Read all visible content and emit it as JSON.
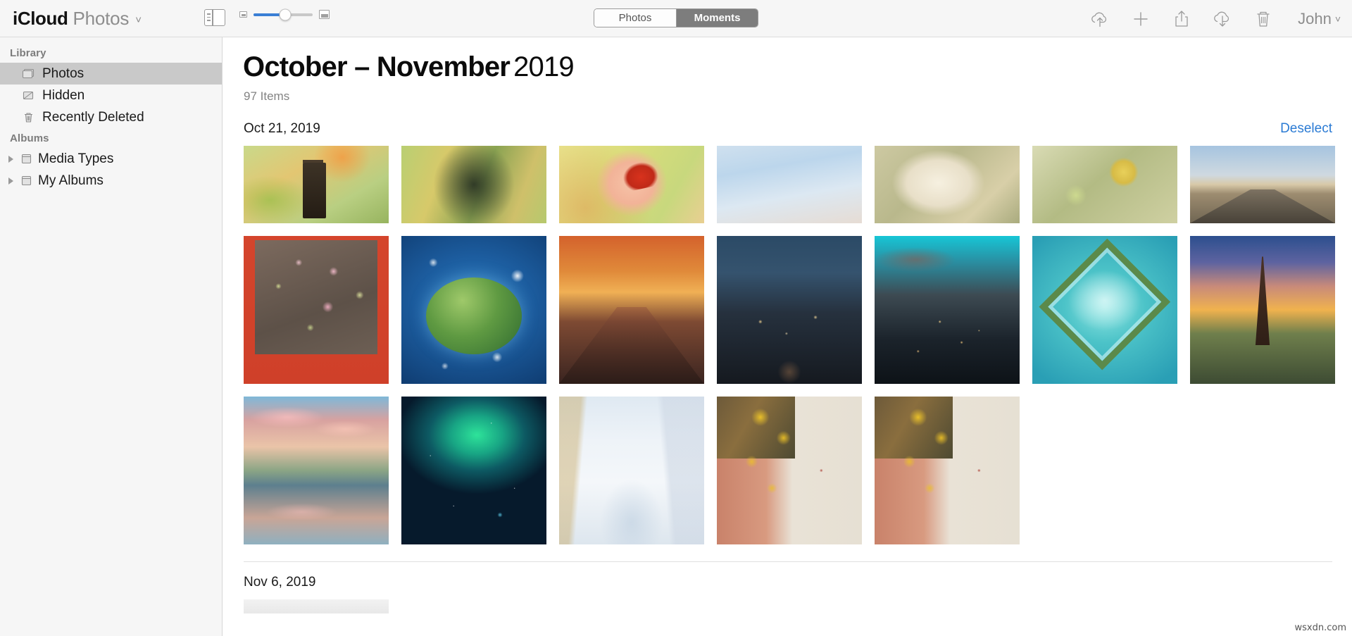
{
  "toolbar": {
    "brand_primary": "iCloud",
    "brand_secondary": "Photos",
    "brand_caret": "˅",
    "sidebar_toggle_name": "sidebar-toggle-icon",
    "zoom_slider_value": 53,
    "segments": [
      {
        "label": "Photos",
        "selected": false
      },
      {
        "label": "Moments",
        "selected": true
      }
    ],
    "icons": [
      "upload-to-icloud-icon",
      "add-icon",
      "share-icon",
      "download-from-icloud-icon",
      "delete-icon"
    ],
    "account_name": "John",
    "account_caret": "˅",
    "accent_color": "#3a7fd5"
  },
  "sidebar": {
    "sections": [
      {
        "header": "Library",
        "items": [
          {
            "label": "Photos",
            "icon": "photos-stack-icon",
            "selected": true
          },
          {
            "label": "Hidden",
            "icon": "hidden-eye-slash-icon",
            "selected": false
          },
          {
            "label": "Recently Deleted",
            "icon": "trash-icon",
            "selected": false
          }
        ]
      },
      {
        "header": "Albums",
        "items": [
          {
            "label": "Media Types",
            "icon": "album-folder-icon",
            "selected": false,
            "expandable": true
          },
          {
            "label": "My Albums",
            "icon": "album-folder-icon",
            "selected": false,
            "expandable": true
          }
        ]
      }
    ]
  },
  "main": {
    "title_range": "October – November",
    "title_year": "2019",
    "item_count": "97 Items",
    "moments": [
      {
        "date": "Oct 21, 2019",
        "action_label": "Deselect",
        "action_color": "#2b7bd4",
        "rows": [
          {
            "orientation": "landscape",
            "photos": [
              {
                "name": "photo-birdhouse-autumn",
                "art": "p-birdhouse",
                "selected": false
              },
              {
                "name": "photo-tree-autumn-leaves",
                "art": "p-tree",
                "selected": false
              },
              {
                "name": "photo-hand-holding-red-maple-leaf",
                "art": "p-leaf-hand",
                "selected": true
              },
              {
                "name": "photo-pastel-sky",
                "art": "p-sky",
                "selected": false
              },
              {
                "name": "photo-white-rose",
                "art": "p-white-rose",
                "selected": false
              },
              {
                "name": "photo-yellow-rose",
                "art": "p-yellow-rose",
                "selected": false
              },
              {
                "name": "photo-desert-road",
                "art": "p-road",
                "selected": false
              }
            ]
          },
          {
            "orientation": "portrait",
            "photos": [
              {
                "name": "photo-pink-blossoms-red-wall",
                "art": "p-blossom",
                "selected": false
              },
              {
                "name": "photo-tiny-planet-castle",
                "art": "p-planet",
                "selected": false
              },
              {
                "name": "photo-sunset-palm-street",
                "art": "p-sunset-street",
                "selected": false
              },
              {
                "name": "photo-night-city-street",
                "art": "p-night-street",
                "selected": false
              },
              {
                "name": "photo-city-skyline-dusk",
                "art": "p-city-night",
                "selected": false
              },
              {
                "name": "photo-heart-shaped-island",
                "art": "p-heart-island",
                "selected": false
              },
              {
                "name": "photo-eiffel-tower-sunset",
                "art": "p-eiffel",
                "selected": false
              }
            ]
          },
          {
            "orientation": "portrait",
            "photos": [
              {
                "name": "photo-cloud-reflection-lake",
                "art": "p-cloud-reflection",
                "selected": false
              },
              {
                "name": "photo-aurora-borealis",
                "art": "p-aurora",
                "selected": false
              },
              {
                "name": "photo-snow-covered-forest",
                "art": "p-snow-forest",
                "selected": false
              },
              {
                "name": "photo-ginkgo-leaves-wall",
                "art": "p-ginkgo",
                "selected": false
              },
              {
                "name": "photo-ginkgo-leaves-wall-duplicate",
                "art": "p-ginkgo",
                "selected": false
              }
            ]
          }
        ]
      },
      {
        "date": "Nov 6, 2019",
        "action_label": "",
        "rows": [
          {
            "orientation": "cut",
            "photos": [
              {
                "name": "photo-document-partial",
                "art": "p-doc-cut",
                "selected": false
              }
            ]
          }
        ]
      }
    ]
  },
  "watermark": "wsxdn.com"
}
